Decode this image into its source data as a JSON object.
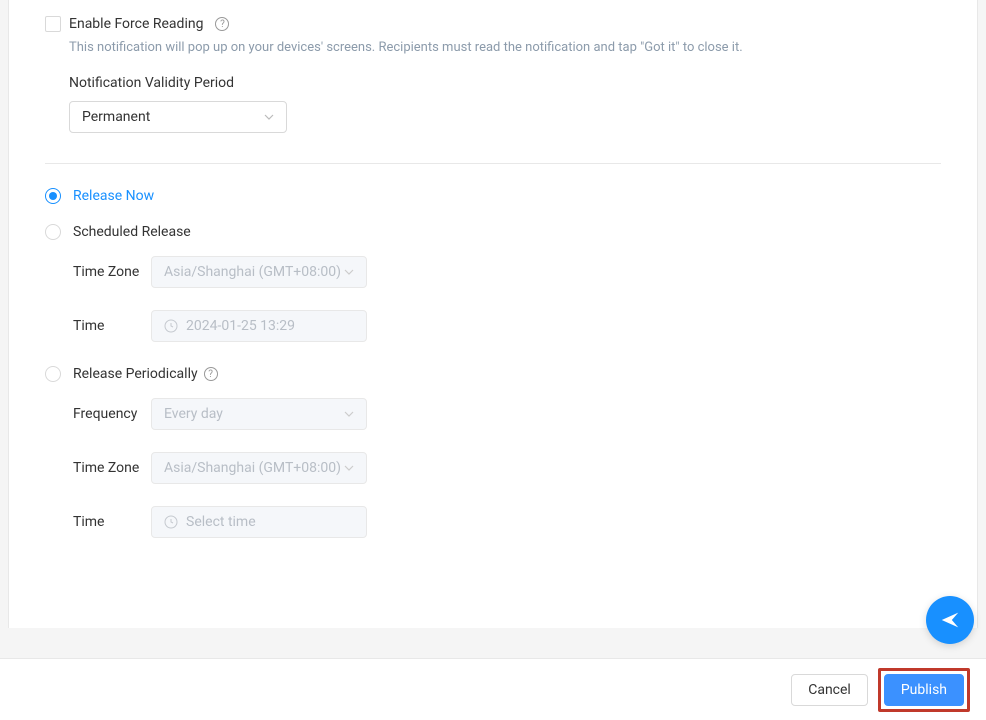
{
  "forceReading": {
    "label": "Enable Force Reading",
    "description": "This notification will pop up on your devices' screens. Recipients must read the notification and tap \"Got it\" to close it."
  },
  "validity": {
    "label": "Notification Validity Period",
    "value": "Permanent"
  },
  "release": {
    "now": {
      "label": "Release Now"
    },
    "scheduled": {
      "label": "Scheduled Release",
      "timezone": {
        "label": "Time Zone",
        "value": "Asia/Shanghai (GMT+08:00)"
      },
      "time": {
        "label": "Time",
        "value": "2024-01-25 13:29"
      }
    },
    "periodic": {
      "label": "Release Periodically",
      "frequency": {
        "label": "Frequency",
        "value": "Every day"
      },
      "timezone": {
        "label": "Time Zone",
        "value": "Asia/Shanghai (GMT+08:00)"
      },
      "time": {
        "label": "Time",
        "placeholder": "Select time"
      }
    }
  },
  "footer": {
    "cancel": "Cancel",
    "publish": "Publish"
  }
}
